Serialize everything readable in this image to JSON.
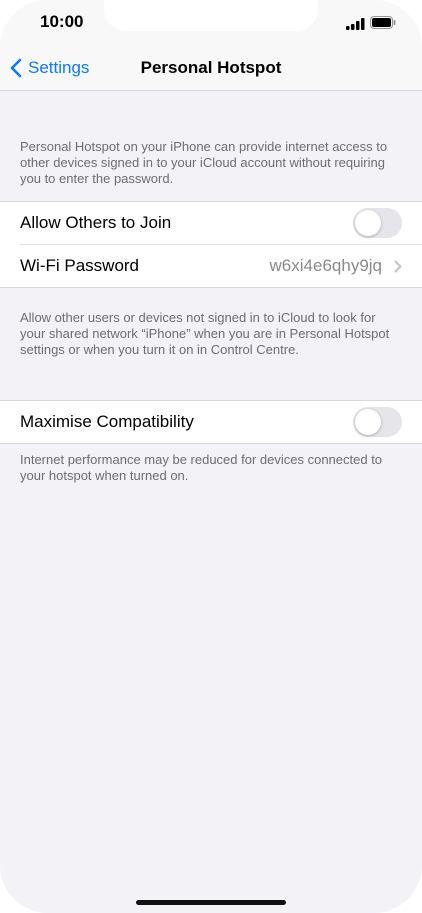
{
  "status": {
    "time": "10:00"
  },
  "nav": {
    "back_label": "Settings",
    "title": "Personal Hotspot"
  },
  "intro_text": "Personal Hotspot on your iPhone can provide internet access to other devices signed in to your iCloud account without requiring you to enter the password.",
  "group1": {
    "allow_label": "Allow Others to Join",
    "allow_on": false,
    "wifi_label": "Wi-Fi Password",
    "wifi_value": "w6xi4e6qhy9jq"
  },
  "allow_footer": "Allow other users or devices not signed in to iCloud to look for your shared network “iPhone” when you are in Personal Hotspot settings or when you turn it on in Control Centre.",
  "group2": {
    "compat_label": "Maximise Compatibility",
    "compat_on": false
  },
  "compat_footer": "Internet performance may be reduced for devices connected to your hotspot when turned on.",
  "colors": {
    "accent": "#0a7aff",
    "background": "#f2f2f7",
    "toggle_off": "#e5e5ea"
  }
}
